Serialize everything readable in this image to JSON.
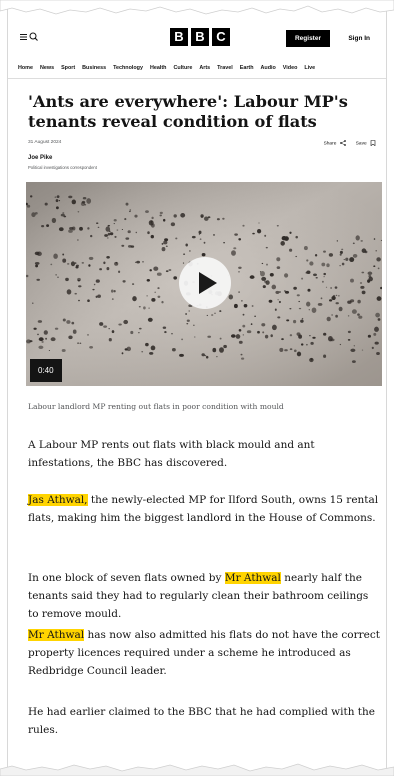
{
  "header": {
    "logo_letters": [
      "B",
      "B",
      "C"
    ],
    "register_label": "Register",
    "signin_label": "Sign In"
  },
  "nav": {
    "items": [
      "Home",
      "News",
      "Sport",
      "Business",
      "Technology",
      "Health",
      "Culture",
      "Arts",
      "Travel",
      "Earth",
      "Audio",
      "Video",
      "Live"
    ]
  },
  "article": {
    "headline": "'Ants are everywhere': Labour MP's tenants reveal condition of flats",
    "date": "31 August 2024",
    "share_label": "Share",
    "save_label": "Save",
    "author_name": "Joe Pike",
    "author_role": "Political investigations correspondent",
    "video_duration": "0:40",
    "video_caption": "Labour landlord MP renting out flats in poor condition with mould",
    "p1": "A Labour MP rents out flats with black mould and ant infestations, the BBC has discovered.",
    "p2_highlight": "Jas Athwal,",
    "p2_rest": " the newly-elected MP for Ilford South, owns 15 rental flats, making him the biggest landlord in the House of Commons.",
    "p3_start": "In one block of seven flats owned by ",
    "p3_highlight": "Mr Athwal",
    "p3_rest": " nearly half the tenants said they had to regularly clean their bathroom ceilings to remove mould.",
    "p4_highlight": "Mr Athwal",
    "p4_rest": " has now also admitted his flats do not have the correct property licences required under a scheme he introduced as Redbridge Council leader.",
    "p5": "He had earlier claimed to the BBC that he had complied with the rules."
  },
  "colors": {
    "highlight": "#ffd400",
    "text": "#141414",
    "muted": "#545658"
  },
  "icons": {
    "menu": "menu-icon",
    "search": "search-icon",
    "share": "share-icon",
    "save": "bookmark-icon",
    "play": "play-icon"
  }
}
